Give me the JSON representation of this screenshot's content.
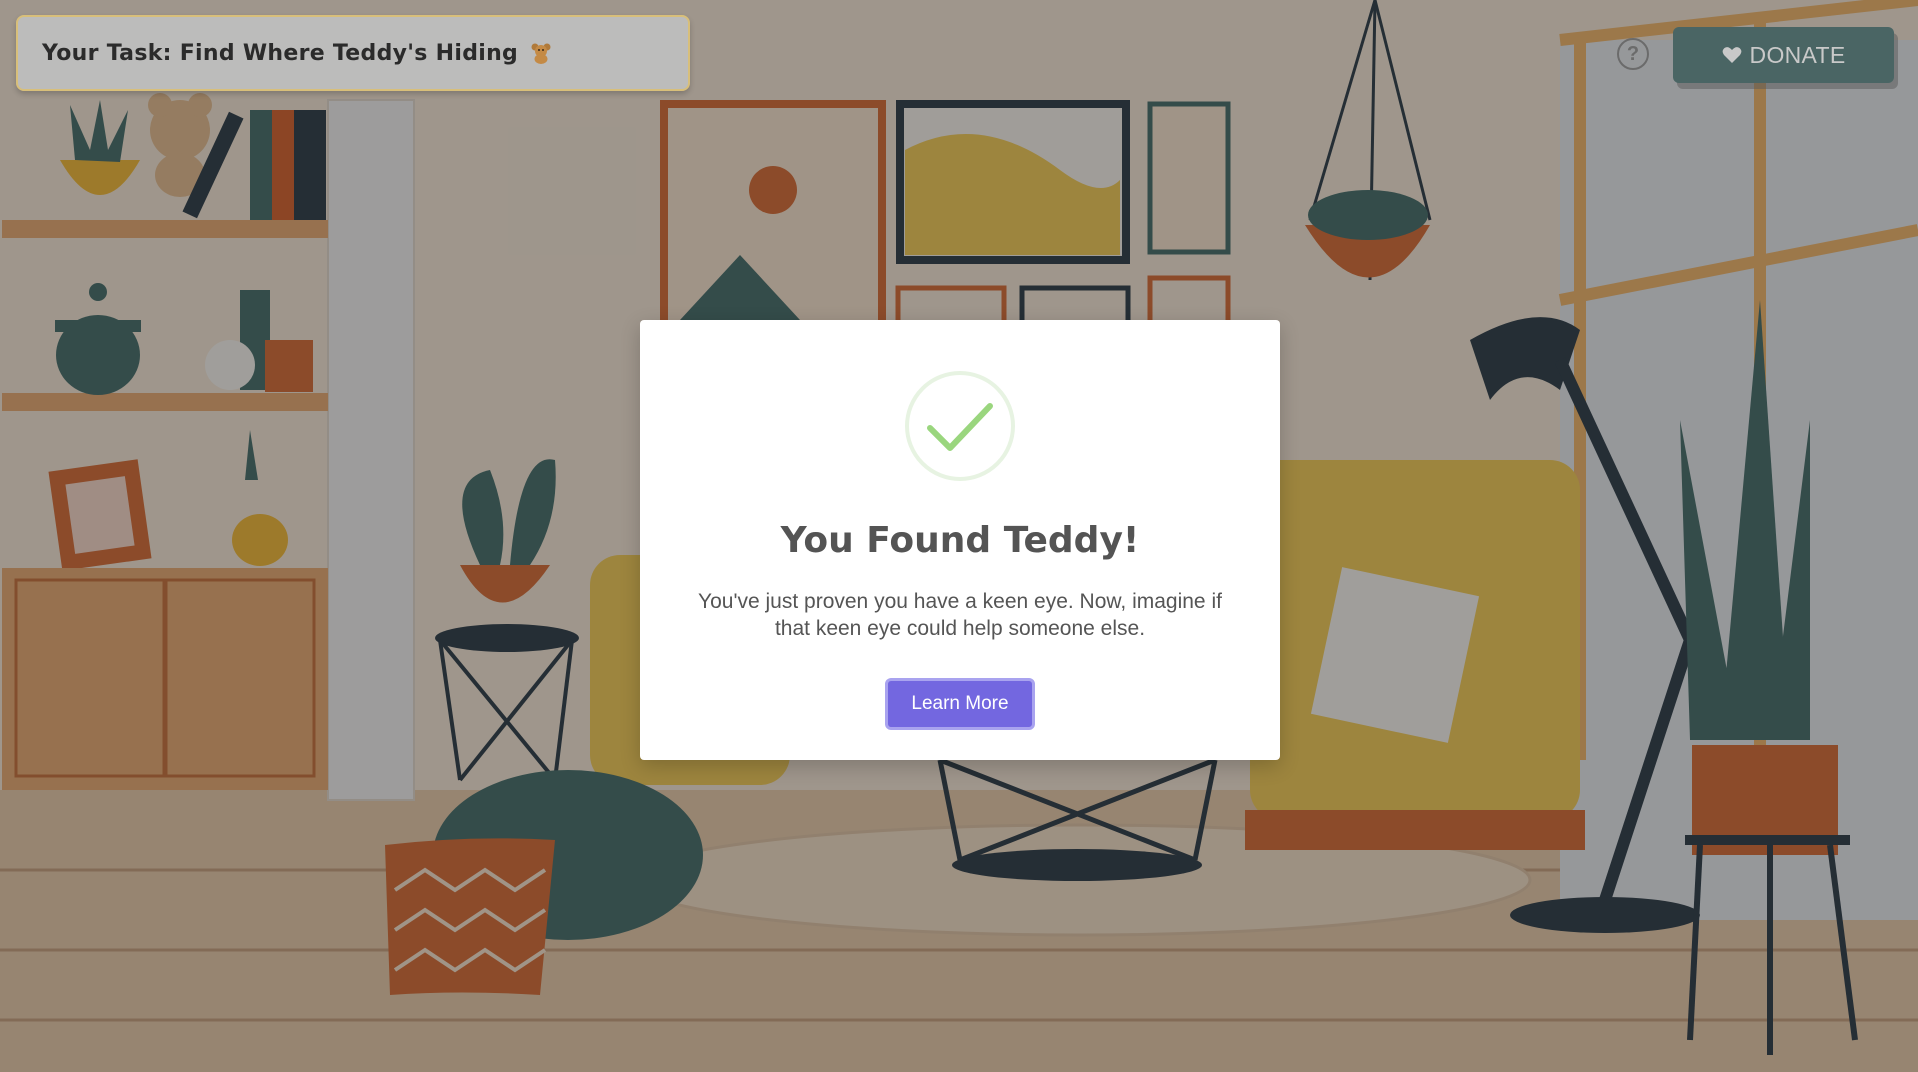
{
  "task": {
    "text": "Your Task: Find Where Teddy's Hiding",
    "icon": "teddy-bear-icon"
  },
  "help": {
    "icon": "question-icon",
    "glyph": "?"
  },
  "donate": {
    "label": "DONATE",
    "icon": "heart-icon",
    "color": "#4a6564"
  },
  "modal": {
    "title": "You Found Teddy!",
    "message": "You've just proven you have a keen eye. Now, imagine if that keen eye could help someone else.",
    "button_label": "Learn More",
    "icon": "checkmark-icon",
    "accent": "#7367e0",
    "check_color": "#8fd18a"
  },
  "scene": {
    "description_icons": [
      "bookshelf",
      "teddy-bear",
      "plants",
      "picture-frames",
      "hanging-planter",
      "armchair",
      "floor-lamp",
      "pouf",
      "cushion",
      "side-table",
      "window"
    ]
  }
}
